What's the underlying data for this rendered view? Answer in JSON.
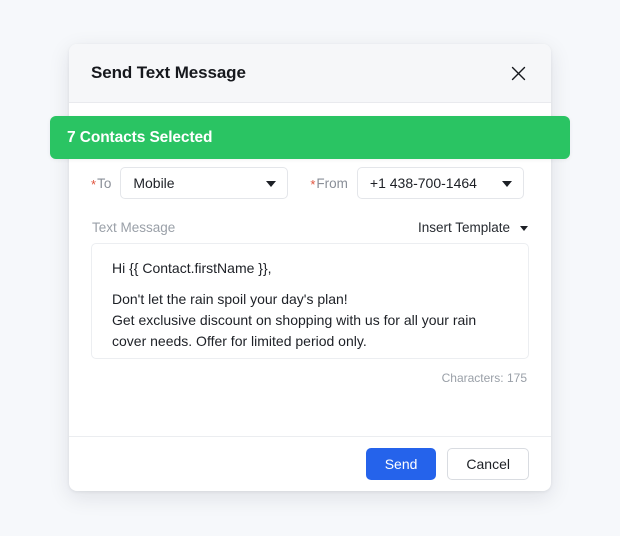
{
  "modal": {
    "title": "Send Text Message",
    "close_icon": "close-icon"
  },
  "banner": {
    "text": "7 Contacts Selected",
    "color": "#2ac463"
  },
  "fields": {
    "to": {
      "required_marker": "*",
      "label": "To",
      "value": "Mobile"
    },
    "from": {
      "required_marker": "*",
      "label": "From",
      "value": "+1 438-700-1464"
    }
  },
  "message": {
    "label": "Text Message",
    "insert_template_label": "Insert Template",
    "lines": [
      "Hi {{ Contact.firstName }},",
      "Don't let the rain spoil your day's plan!",
      "Get exclusive discount on shopping with us for all your rain cover needs. Offer for limited period only."
    ],
    "char_count": "Characters: 175"
  },
  "footer": {
    "send_label": "Send",
    "cancel_label": "Cancel",
    "primary_color": "#2563eb"
  }
}
